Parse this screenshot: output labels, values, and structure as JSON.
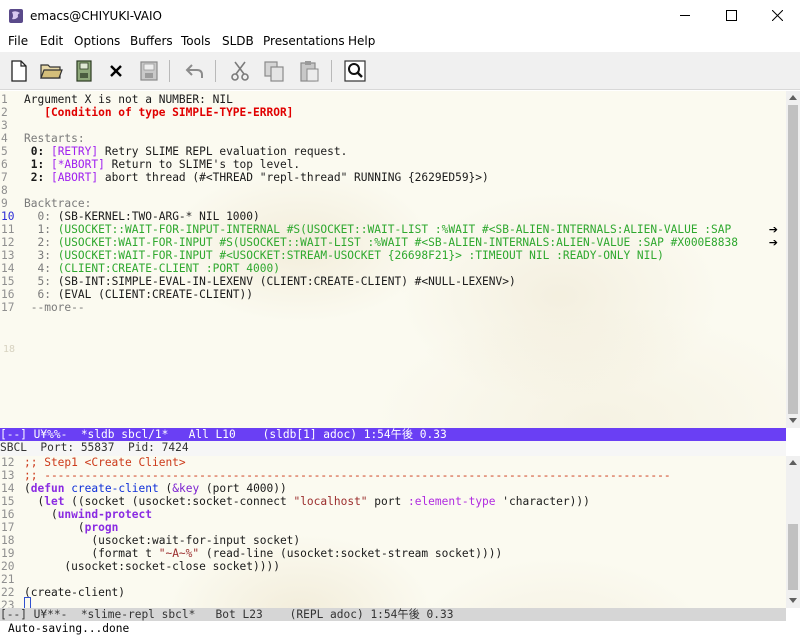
{
  "window": {
    "title": "emacs@CHIYUKI-VAIO",
    "icon": "emacs-gnu-icon",
    "controls": [
      "minimize-icon",
      "maximize-icon",
      "close-icon"
    ]
  },
  "menu": [
    "File",
    "Edit",
    "Options",
    "Buffers",
    "Tools",
    "SLDB",
    "Presentations",
    "Help"
  ],
  "toolbar": {
    "icons": [
      "new-file-icon",
      "open-folder-icon",
      "save-disk-icon",
      "close-x-icon",
      "save-as-icon",
      "undo-icon",
      "cut-icon",
      "copy-icon",
      "paste-icon",
      "search-icon"
    ]
  },
  "sldb": {
    "lines": [
      {
        "n": "1",
        "segs": [
          {
            "t": "Argument X is not a NUMBER: NIL",
            "c": ""
          }
        ]
      },
      {
        "n": "2",
        "segs": [
          {
            "t": "   [Condition of type SIMPLE-TYPE-ERROR]",
            "c": "c-red"
          }
        ]
      },
      {
        "n": "3",
        "segs": []
      },
      {
        "n": "4",
        "segs": [
          {
            "t": "Restarts:",
            "c": "c-gray"
          }
        ]
      },
      {
        "n": "5",
        "segs": [
          {
            "t": " 0: ",
            "c": "b"
          },
          {
            "t": "[RETRY]",
            "c": "c-purple"
          },
          {
            "t": " Retry SLIME REPL evaluation request.",
            "c": ""
          }
        ]
      },
      {
        "n": "6",
        "segs": [
          {
            "t": " 1: ",
            "c": "b"
          },
          {
            "t": "[*ABORT]",
            "c": "c-purple"
          },
          {
            "t": " Return to SLIME's top level.",
            "c": ""
          }
        ]
      },
      {
        "n": "7",
        "segs": [
          {
            "t": " 2: ",
            "c": "b"
          },
          {
            "t": "[ABORT]",
            "c": "c-purple"
          },
          {
            "t": " abort thread (#<THREAD \"repl-thread\" RUNNING {2629ED59}>)",
            "c": ""
          }
        ]
      },
      {
        "n": "8",
        "segs": []
      },
      {
        "n": "9",
        "segs": [
          {
            "t": "Backtrace:",
            "c": "c-gray"
          }
        ]
      },
      {
        "n": "10",
        "segs": [
          {
            "t": "  0: ",
            "c": "c-gray"
          },
          {
            "t": "(SB-KERNEL:TWO-ARG-* NIL 1000)",
            "c": ""
          }
        ],
        "cur": true
      },
      {
        "n": "11",
        "segs": [
          {
            "t": "  1: ",
            "c": "c-gray"
          },
          {
            "t": "(USOCKET::WAIT-FOR-INPUT-INTERNAL #S(USOCKET::WAIT-LIST :%WAIT #<SB-ALIEN-INTERNALS:ALIEN-VALUE :SAP",
            "c": "c-green"
          }
        ],
        "cont": true
      },
      {
        "n": "12",
        "segs": [
          {
            "t": "  2: ",
            "c": "c-gray"
          },
          {
            "t": "(USOCKET:WAIT-FOR-INPUT #S(USOCKET::WAIT-LIST :%WAIT #<SB-ALIEN-INTERNALS:ALIEN-VALUE :SAP #X000E8838",
            "c": "c-green"
          }
        ],
        "cont": true
      },
      {
        "n": "13",
        "segs": [
          {
            "t": "  3: ",
            "c": "c-gray"
          },
          {
            "t": "(USOCKET:WAIT-FOR-INPUT #<USOCKET:STREAM-USOCKET {26698F21}> :TIMEOUT NIL :READY-ONLY NIL)",
            "c": "c-green"
          }
        ]
      },
      {
        "n": "14",
        "segs": [
          {
            "t": "  4: ",
            "c": "c-gray"
          },
          {
            "t": "(CLIENT:CREATE-CLIENT :PORT 4000)",
            "c": "c-green"
          }
        ]
      },
      {
        "n": "15",
        "segs": [
          {
            "t": "  5: ",
            "c": "c-gray"
          },
          {
            "t": "(SB-INT:SIMPLE-EVAL-IN-LEXENV (CLIENT:CREATE-CLIENT) #<NULL-LEXENV>)",
            "c": ""
          }
        ]
      },
      {
        "n": "16",
        "segs": [
          {
            "t": "  6: ",
            "c": "c-gray"
          },
          {
            "t": "(EVAL (CLIENT:CREATE-CLIENT))",
            "c": ""
          }
        ]
      },
      {
        "n": "17",
        "segs": [
          {
            "t": " --more--",
            "c": "c-gray"
          }
        ]
      }
    ],
    "watermark": "18",
    "modeline": "[--] U¥%%-  *sldb sbcl/1*   All L10    (sldb[1] adoc) 1:54午後 0.33"
  },
  "slime_status": "SBCL  Port: 55837  Pid: 7424",
  "repl": {
    "lines": [
      {
        "n": "12",
        "segs": [
          {
            "t": ";; Step1 <Create Client>",
            "c": "c-cmt"
          }
        ]
      },
      {
        "n": "13",
        "segs": [
          {
            "t": ";; ---------------------------------------------------------------------------------------------",
            "c": "c-cmt"
          }
        ]
      },
      {
        "n": "14",
        "segs": [
          {
            "t": "(",
            "c": ""
          },
          {
            "t": "defun",
            "c": "c-kw"
          },
          {
            "t": " ",
            "c": ""
          },
          {
            "t": "create-client",
            "c": "c-fn"
          },
          {
            "t": " (",
            "c": ""
          },
          {
            "t": "&key",
            "c": "c-defn"
          },
          {
            "t": " (port 4000))",
            "c": ""
          }
        ]
      },
      {
        "n": "15",
        "segs": [
          {
            "t": "  (",
            "c": ""
          },
          {
            "t": "let",
            "c": "c-kw"
          },
          {
            "t": " ((socket (usocket:socket-connect ",
            "c": ""
          },
          {
            "t": "\"localhost\"",
            "c": "c-str"
          },
          {
            "t": " port ",
            "c": ""
          },
          {
            "t": ":element-type",
            "c": "c-kwd"
          },
          {
            "t": " 'character)))",
            "c": ""
          }
        ]
      },
      {
        "n": "16",
        "segs": [
          {
            "t": "    (",
            "c": ""
          },
          {
            "t": "unwind-protect",
            "c": "c-kw"
          }
        ]
      },
      {
        "n": "17",
        "segs": [
          {
            "t": "        (",
            "c": ""
          },
          {
            "t": "progn",
            "c": "c-kw"
          }
        ]
      },
      {
        "n": "18",
        "segs": [
          {
            "t": "          (usocket:wait-for-input socket)",
            "c": ""
          }
        ]
      },
      {
        "n": "19",
        "segs": [
          {
            "t": "          (format t ",
            "c": ""
          },
          {
            "t": "\"~A~%\"",
            "c": "c-str"
          },
          {
            "t": " (read-line (usocket:socket-stream socket))))",
            "c": ""
          }
        ]
      },
      {
        "n": "20",
        "segs": [
          {
            "t": "      (usocket:socket-close socket))))",
            "c": ""
          }
        ]
      },
      {
        "n": "21",
        "segs": []
      },
      {
        "n": "22",
        "segs": [
          {
            "t": "(create-client)",
            "c": ""
          }
        ]
      },
      {
        "n": "23",
        "segs": []
      }
    ],
    "modeline": "[--] U¥**-  *slime-repl sbcl*   Bot L23    (REPL adoc) 1:54午後 0.33"
  },
  "echo_area": "Auto-saving...done",
  "colors": {
    "modeline_active": "#6a3ff4",
    "pane_bg": "#fbfaf0",
    "condition_red": "#e00000",
    "restart_purple": "#a020f0",
    "backtrace_green": "#2ea82e"
  }
}
